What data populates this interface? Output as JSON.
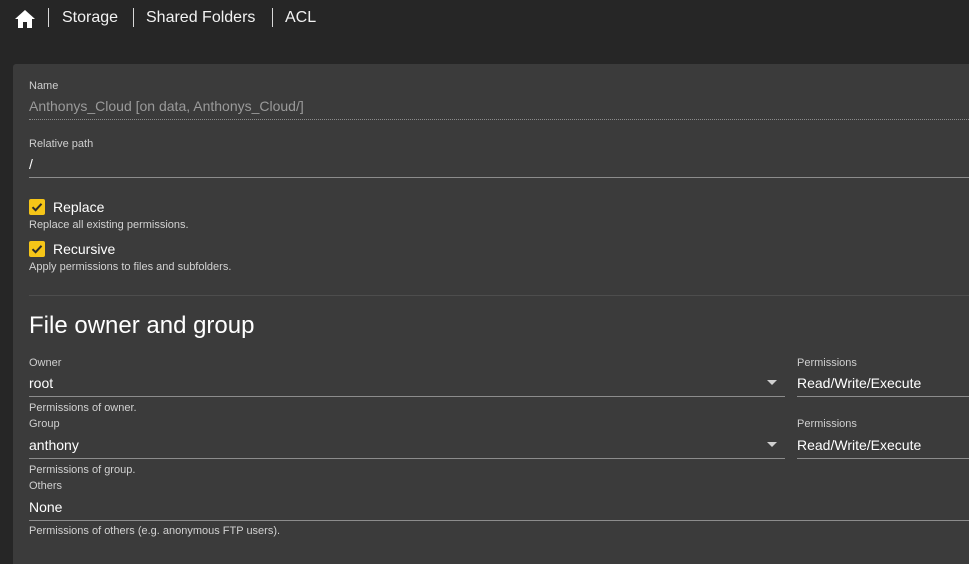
{
  "breadcrumb": {
    "home_icon": "home-icon",
    "items": [
      "Storage",
      "Shared Folders",
      "ACL"
    ]
  },
  "form": {
    "name": {
      "label": "Name",
      "value": "Anthonys_Cloud [on data, Anthonys_Cloud/]"
    },
    "relative_path": {
      "label": "Relative path",
      "value": "/"
    },
    "replace": {
      "label": "Replace",
      "checked": true,
      "hint": "Replace all existing permissions."
    },
    "recursive": {
      "label": "Recursive",
      "checked": true,
      "hint": "Apply permissions to files and subfolders."
    }
  },
  "owner_group": {
    "title": "File owner and group",
    "owner": {
      "label": "Owner",
      "value": "root",
      "permissions_label": "Permissions",
      "permissions_value": "Read/Write/Execute",
      "hint": "Permissions of owner."
    },
    "group": {
      "label": "Group",
      "value": "anthony",
      "permissions_label": "Permissions",
      "permissions_value": "Read/Write/Execute",
      "hint": "Permissions of group."
    },
    "others": {
      "label": "Others",
      "value": "None",
      "hint": "Permissions of others (e.g. anonymous FTP users)."
    }
  },
  "colors": {
    "accent": "#f5c518",
    "background": "#262626",
    "panel": "#3b3b3b"
  }
}
